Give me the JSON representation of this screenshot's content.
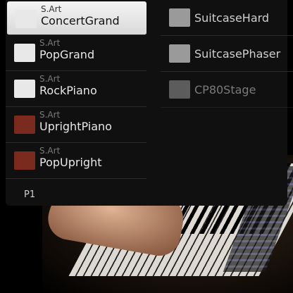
{
  "voice_list": {
    "left_column": [
      {
        "category": "S.Art",
        "name": "ConcertGrand",
        "icon": "grand-piano-icon",
        "selected": true
      },
      {
        "category": "S.Art",
        "name": "PopGrand",
        "icon": "grand-piano-icon",
        "selected": false
      },
      {
        "category": "S.Art",
        "name": "RockPiano",
        "icon": "grand-piano-icon",
        "selected": false
      },
      {
        "category": "S.Art",
        "name": "UprightPiano",
        "icon": "upright-piano-icon",
        "selected": false
      },
      {
        "category": "S.Art",
        "name": "PopUpright",
        "icon": "upright-piano-icon",
        "selected": false
      }
    ],
    "right_column": [
      {
        "name": "SuitcaseHard",
        "icon": "electric-piano-icon"
      },
      {
        "name": "SuitcasePhaser",
        "icon": "electric-piano-icon"
      },
      {
        "name": "CP80Stage",
        "icon": "stage-piano-icon"
      }
    ]
  },
  "pagination": {
    "label": "P1"
  },
  "colors": {
    "selected_bg": "#e9e9e9",
    "list_bg": "#101010",
    "text": "#e8e8e8",
    "category_text": "#7a7a7a"
  }
}
